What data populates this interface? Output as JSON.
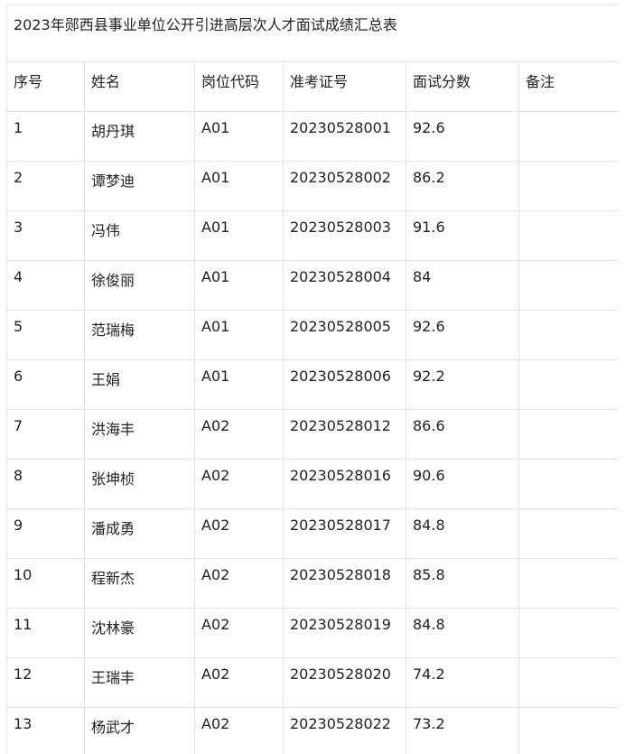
{
  "title": "2023年郧西县事业单位公开引进高层次人才面试成绩汇总表",
  "columns": [
    "序号",
    "姓名",
    "岗位代码",
    "准考证号",
    "面试分数",
    "备注"
  ],
  "rows": [
    [
      "1",
      "胡丹琪",
      "A01",
      "20230528001",
      "92.6",
      ""
    ],
    [
      "2",
      "谭梦迪",
      "A01",
      "20230528002",
      "86.2",
      ""
    ],
    [
      "3",
      "冯伟",
      "A01",
      "20230528003",
      "91.6",
      ""
    ],
    [
      "4",
      "徐俊丽",
      "A01",
      "20230528004",
      "84",
      ""
    ],
    [
      "5",
      "范瑞梅",
      "A01",
      "20230528005",
      "92.6",
      ""
    ],
    [
      "6",
      "王娟",
      "A01",
      "20230528006",
      "92.2",
      ""
    ],
    [
      "7",
      "洪海丰",
      "A02",
      "20230528012",
      "86.6",
      ""
    ],
    [
      "8",
      "张坤桢",
      "A02",
      "20230528016",
      "90.6",
      ""
    ],
    [
      "9",
      "潘成勇",
      "A02",
      "20230528017",
      "84.8",
      ""
    ],
    [
      "10",
      "程新杰",
      "A02",
      "20230528018",
      "85.8",
      ""
    ],
    [
      "11",
      "沈林豪",
      "A02",
      "20230528019",
      "84.8",
      ""
    ],
    [
      "12",
      "王瑞丰",
      "A02",
      "20230528020",
      "74.2",
      ""
    ],
    [
      "13",
      "杨武才",
      "A02",
      "20230528022",
      "73.2",
      ""
    ]
  ]
}
